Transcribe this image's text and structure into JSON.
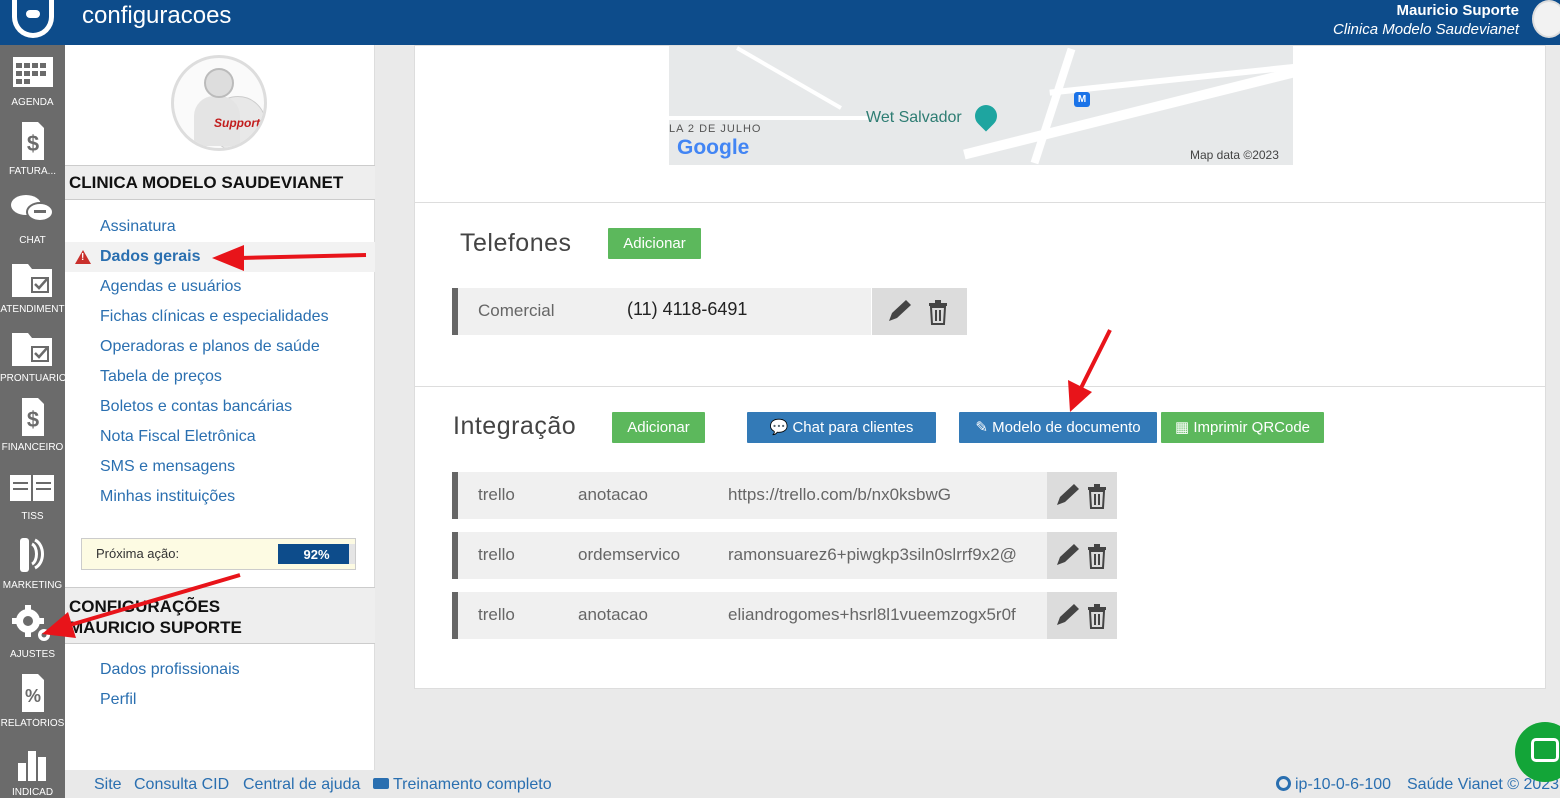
{
  "header": {
    "title": "configuracoes",
    "user_name": "Mauricio Suporte",
    "clinic_name": "Clinica Modelo Saudevianet"
  },
  "rail": [
    {
      "label": "AGENDA",
      "icon": "calendar-icon"
    },
    {
      "label": "FATURA...",
      "icon": "invoice-icon"
    },
    {
      "label": "CHAT",
      "icon": "chat-icon"
    },
    {
      "label": "ATENDIMENT",
      "icon": "folder-check-icon"
    },
    {
      "label": "PRONTUÁRIO",
      "icon": "folder-check-icon"
    },
    {
      "label": "FINANCEIRO",
      "icon": "dollar-doc-icon"
    },
    {
      "label": "TISS",
      "icon": "book-icon"
    },
    {
      "label": "MARKETING",
      "icon": "phone-icon"
    },
    {
      "label": "AJUSTES",
      "icon": "gear-icon"
    },
    {
      "label": "RELATÓRIOS",
      "icon": "percent-icon"
    },
    {
      "label": "INDICAD",
      "icon": "bar-chart-icon"
    }
  ],
  "panel": {
    "avatar_text": "Support",
    "clinic_heading": "CLINICA MODELO SAUDEVIANET",
    "clinic_links": [
      "Assinatura",
      "Dados gerais",
      "Agendas e usuários",
      "Fichas clínicas e especialidades",
      "Operadoras e planos de saúde",
      "Tabela de preços",
      "Boletos e contas bancárias",
      "Nota Fiscal Eletrônica",
      "SMS e mensagens",
      "Minhas instituições"
    ],
    "next_action_label": "Próxima ação:",
    "next_action_percent": "92%",
    "next_action_value": 0.92,
    "user_heading_line1": "CONFIGURAÇÕES",
    "user_heading_line2": "MAURICIO SUPORTE",
    "user_links": [
      "Dados profissionais",
      "Perfil"
    ]
  },
  "map": {
    "place_label": "Wet Salvador",
    "street_label": "LA 2 DE JULHO",
    "brand": "Google",
    "attribution": "Map data ©2023",
    "metro_label": "M"
  },
  "phones": {
    "title": "Telefones",
    "add_label": "Adicionar",
    "rows": [
      {
        "type": "Comercial",
        "number": "(11) 4118-6491"
      }
    ]
  },
  "integration": {
    "title": "Integração",
    "add_label": "Adicionar",
    "chat_label": "Chat para clientes",
    "document_label": "Modelo de documento",
    "qr_label": "Imprimir QRCode",
    "rows": [
      {
        "service": "trello",
        "kind": "anotacao",
        "value": "https://trello.com/b/nx0ksbwG"
      },
      {
        "service": "trello",
        "kind": "ordemservico",
        "value": "ramonsuarez6+piwgkp3siln0slrrf9x2@"
      },
      {
        "service": "trello",
        "kind": "anotacao",
        "value": "eliandrogomes+hsrl8l1vueemzogx5r0f"
      }
    ]
  },
  "footer": {
    "links": [
      "Site",
      "Consulta CID",
      "Central de ajuda",
      "Treinamento completo"
    ],
    "server": "ip-10-0-6-100",
    "copyright": "Saúde Vianet © 2023"
  },
  "colors": {
    "brand_blue": "#0d4c8b",
    "success_green": "#5cb85c",
    "primary_blue": "#337ab7",
    "link_blue": "#2a6fb0",
    "annotation_red": "#e8141a"
  }
}
